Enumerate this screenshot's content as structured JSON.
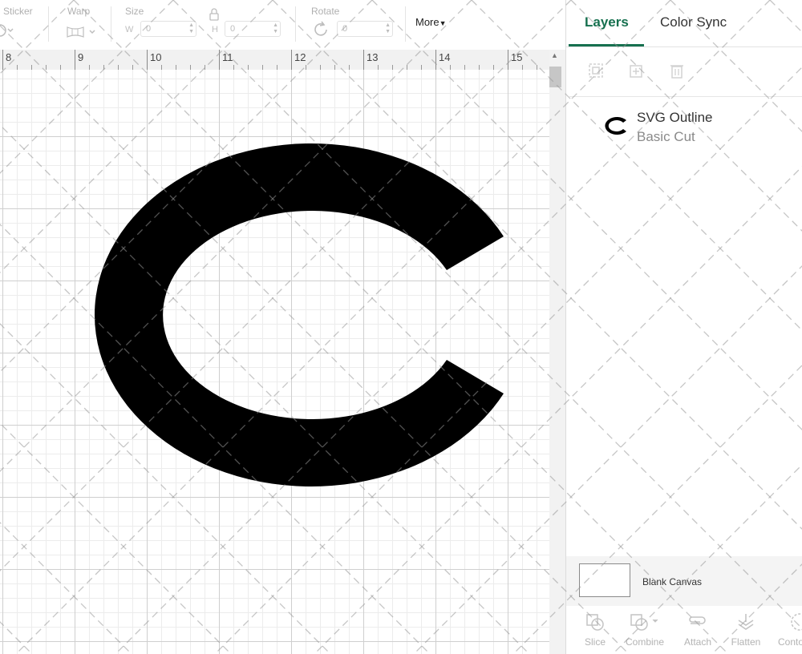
{
  "toolbar": {
    "sticker_label": "Sticker",
    "warp_label": "Warp",
    "size_label": "Size",
    "size_w_label": "W",
    "size_w_value": "0",
    "size_h_label": "H",
    "size_h_value": "0",
    "rotate_label": "Rotate",
    "rotate_value": "0",
    "more_label": "More"
  },
  "ruler": {
    "numbers": [
      "8",
      "9",
      "10",
      "11",
      "12",
      "13",
      "14",
      "15"
    ]
  },
  "panel": {
    "tabs": [
      "Layers",
      "Color Sync"
    ],
    "active_tab": "Layers",
    "layer": {
      "name": "SVG Outline",
      "type": "Basic Cut"
    },
    "blank_canvas_label": "Blank Canvas",
    "bottom_tools": [
      "Slice",
      "Combine",
      "Attach",
      "Flatten",
      "Conto"
    ]
  },
  "colors": {
    "accent": "#16704f",
    "shape_fill": "#000000"
  }
}
